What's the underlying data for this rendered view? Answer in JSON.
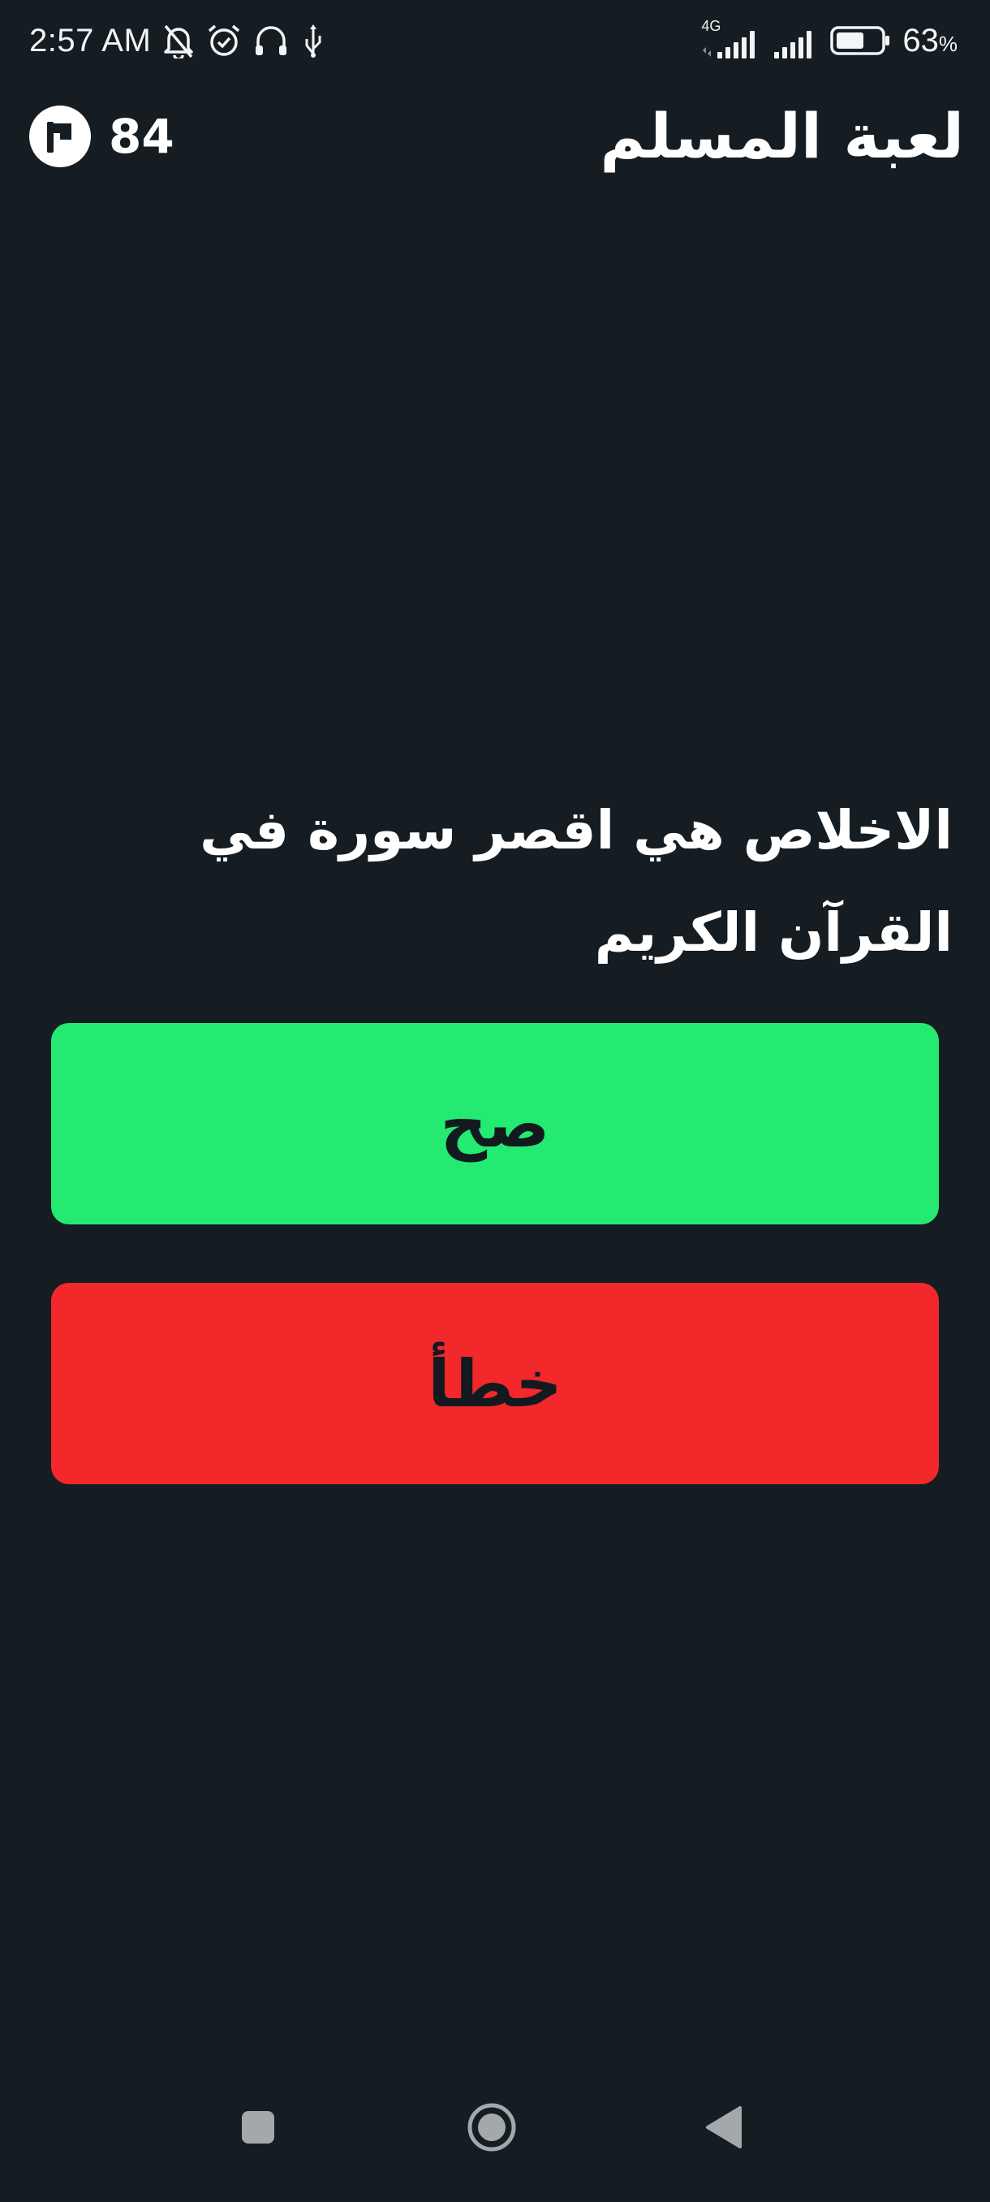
{
  "status_bar": {
    "time": "2:57 AM",
    "network_label": "4G",
    "battery_percent": "63",
    "battery_sign": "%",
    "battery_level": 0.63,
    "icons": [
      "bell-off-icon",
      "alarm-icon",
      "headphones-icon",
      "usb-icon",
      "signal-icon",
      "signal-icon",
      "battery-icon"
    ]
  },
  "header": {
    "title": "لعبة المسلم",
    "score": "84",
    "score_icon": "flag-icon"
  },
  "question": {
    "text": "الاخلاص هي اقصر سورة في القرآن الكريم"
  },
  "answers": {
    "true_label": "صح",
    "false_label": "خطأ"
  },
  "nav_bar": {
    "icons": [
      "recents-square-icon",
      "home-circle-icon",
      "back-triangle-icon"
    ]
  },
  "colors": {
    "background": "#151d22",
    "true_button": "#25ea72",
    "false_button": "#f2282b",
    "button_text": "#121a1f",
    "foreground": "#ffffff"
  }
}
